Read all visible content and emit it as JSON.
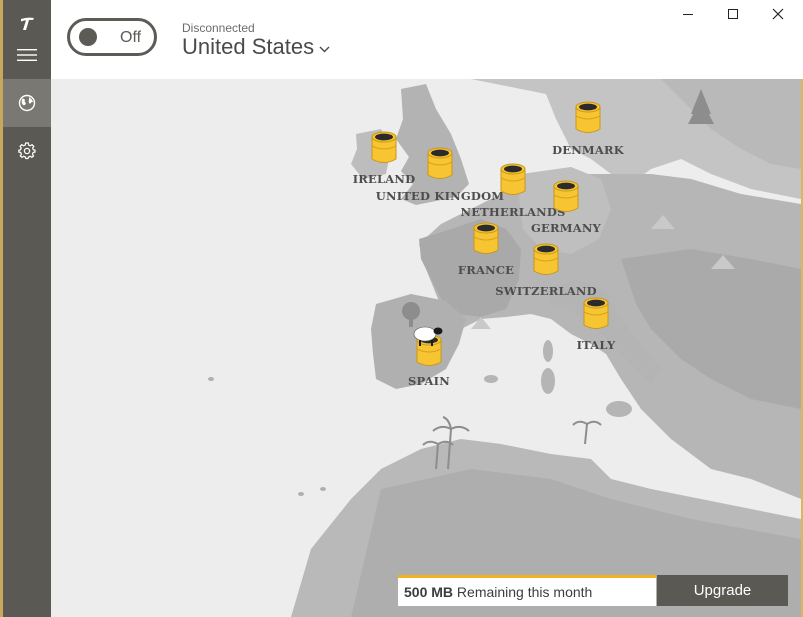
{
  "app": {
    "name": "TunnelBear"
  },
  "header": {
    "toggle_label": "Off",
    "status": "Disconnected",
    "country": "United States"
  },
  "sidebar": {
    "items": [
      {
        "name": "menu",
        "icon": "hamburger-menu-icon",
        "active": false
      },
      {
        "name": "map",
        "icon": "globe-icon",
        "active": true
      },
      {
        "name": "settings",
        "icon": "gear-icon",
        "active": false
      }
    ]
  },
  "map": {
    "countries": [
      {
        "label": "IRELAND"
      },
      {
        "label": "UNITED KINGDOM"
      },
      {
        "label": "NETHERLANDS"
      },
      {
        "label": "DENMARK"
      },
      {
        "label": "GERMANY"
      },
      {
        "label": "FRANCE"
      },
      {
        "label": "SWITZERLAND"
      },
      {
        "label": "ITALY"
      },
      {
        "label": "SPAIN"
      }
    ]
  },
  "footer": {
    "data_amount": "500 MB",
    "data_suffix": "Remaining this month",
    "upgrade_label": "Upgrade"
  },
  "colors": {
    "accent": "#f2b21b",
    "sidebar": "#5b5953",
    "tunnel": "#f7c531",
    "land": "#b2b2b2",
    "sea": "#ededed"
  }
}
